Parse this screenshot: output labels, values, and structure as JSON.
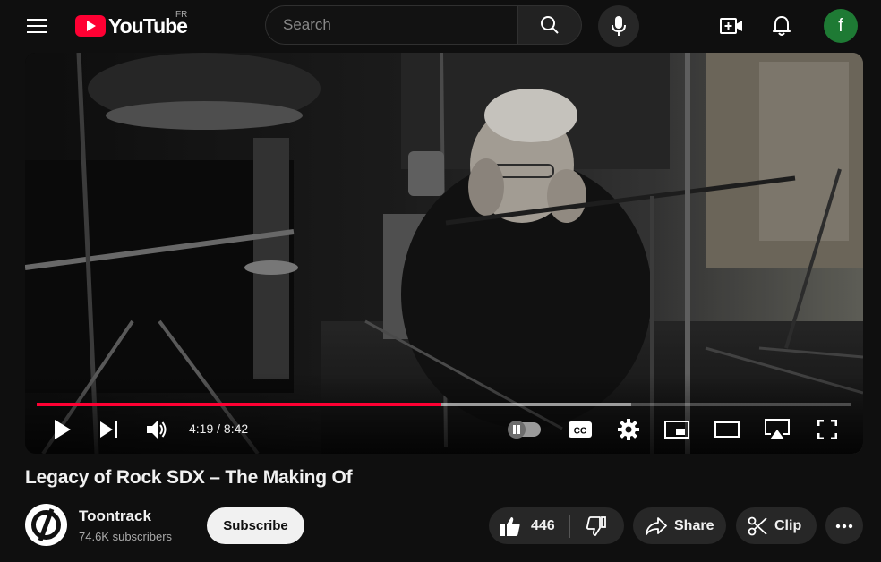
{
  "header": {
    "logo_text": "YouTube",
    "region": "FR",
    "search_placeholder": "Search",
    "avatar_letter": "f"
  },
  "player": {
    "time_current": "4:19",
    "time_separator": " / ",
    "time_total": "8:42",
    "progress_played_fraction": 0.497,
    "progress_loaded_fraction": 0.73,
    "accent_color": "#ff0033",
    "icons": [
      "play-icon",
      "next-icon",
      "volume-icon",
      "autoplay-toggle",
      "cc-icon",
      "settings-icon",
      "miniplayer-icon",
      "theater-icon",
      "airplay-icon",
      "fullscreen-icon"
    ]
  },
  "video": {
    "title": "Legacy of Rock SDX – The Making Of",
    "channel_name": "Toontrack",
    "subscribers": "74.6K subscribers",
    "subscribe_label": "Subscribe",
    "like_count": "446",
    "share_label": "Share",
    "clip_label": "Clip"
  }
}
